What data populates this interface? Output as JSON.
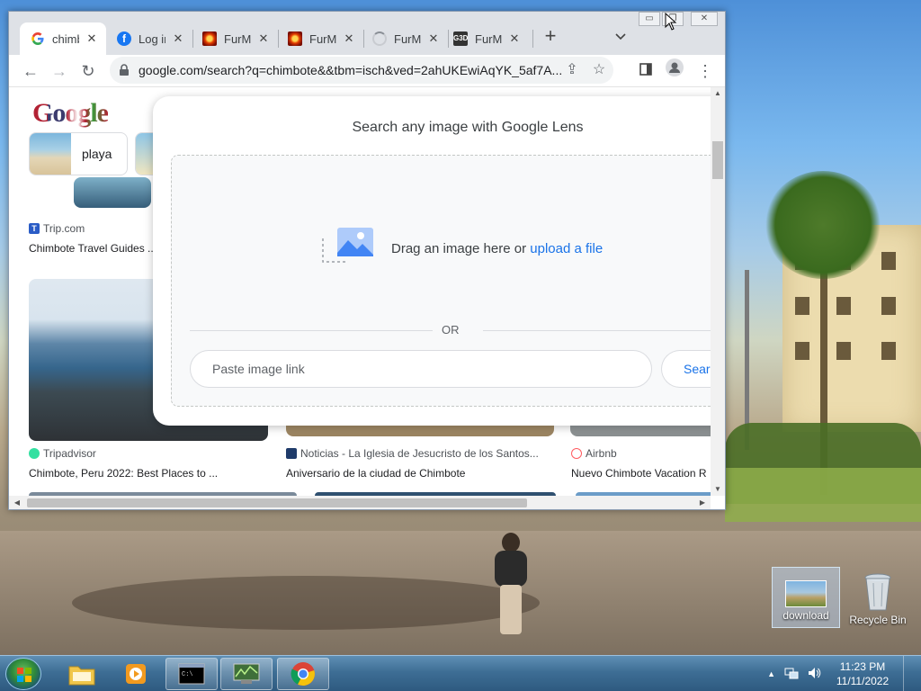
{
  "browser": {
    "tabs": [
      {
        "title": "chimbote",
        "favicon": "google-icon",
        "active": true
      },
      {
        "title": "Log in",
        "favicon": "facebook-icon"
      },
      {
        "title": "FurMark",
        "favicon": "furmark-icon"
      },
      {
        "title": "FurMark",
        "favicon": "furmark-icon"
      },
      {
        "title": "FurMark",
        "favicon": "loading-icon"
      },
      {
        "title": "FurMark",
        "favicon": "gpu-icon"
      }
    ],
    "url": "google.com/search?q=chimbote&&tbm=isch&ved=2ahUKEwiAqYK_5af7A...",
    "colors": {
      "accent": "#1a73e8",
      "tabstrip": "#dee1e6"
    }
  },
  "page": {
    "logo": "Google",
    "chips": [
      {
        "label": "playa"
      }
    ],
    "results_row1": [
      {
        "source": "Trip.com",
        "caption": "Chimbote Travel Guides ..."
      }
    ],
    "results_row2": [
      {
        "source": "Tripadvisor",
        "caption": "Chimbote, Peru 2022: Best Places to ..."
      },
      {
        "source": "Noticias - La Iglesia de Jesucristo de los Santos...",
        "caption": "Aniversario de la ciudad de Chimbote"
      },
      {
        "source": "Airbnb",
        "caption": "Nuevo Chimbote Vacation R"
      }
    ]
  },
  "lens": {
    "heading": "Search any image with Google Lens",
    "drag_text": "Drag an image here or",
    "upload_link": "upload a file",
    "or_text": "OR",
    "paste_placeholder": "Paste image link",
    "search_label": "Search"
  },
  "desktop": {
    "icons": [
      {
        "label": "download",
        "selected": true
      },
      {
        "label": "Recycle Bin"
      }
    ]
  },
  "taskbar": {
    "time": "11:23 PM",
    "date": "11/11/2022"
  }
}
